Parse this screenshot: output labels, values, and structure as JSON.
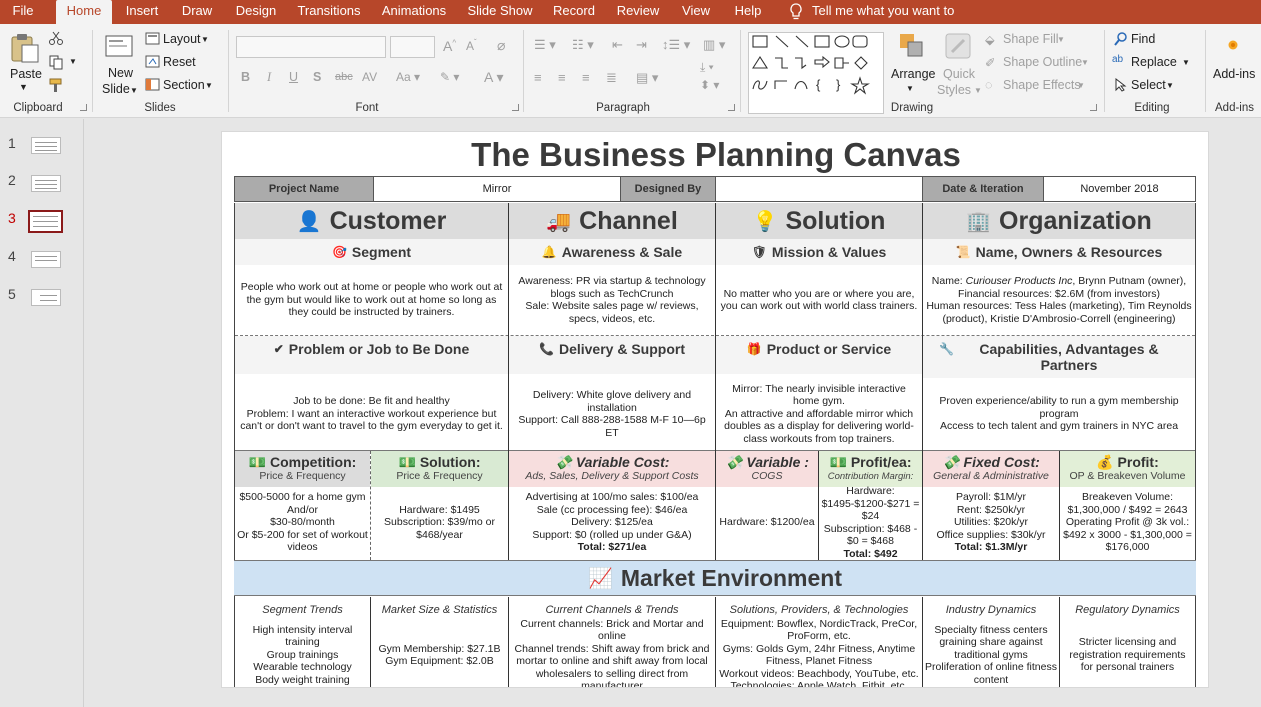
{
  "tabs": [
    "File",
    "Home",
    "Insert",
    "Draw",
    "Design",
    "Transitions",
    "Animations",
    "Slide Show",
    "Record",
    "Review",
    "View",
    "Help"
  ],
  "tell_me": "Tell me what you want to do",
  "ribbon": {
    "paste": "Paste",
    "clipboard": "Clipboard",
    "new_slide_1": "New",
    "new_slide_2": "Slide",
    "layout": "Layout",
    "reset": "Reset",
    "section": "Section",
    "slides": "Slides",
    "font": "Font",
    "paragraph": "Paragraph",
    "arrange": "Arrange",
    "quick_styles_1": "Quick",
    "quick_styles_2": "Styles",
    "shape_fill": "Shape Fill",
    "shape_outline": "Shape Outline",
    "shape_effects": "Shape Effects",
    "drawing": "Drawing",
    "find": "Find",
    "replace": "Replace",
    "select": "Select",
    "editing": "Editing",
    "addins": "Add-ins",
    "addins_group": "Add-ins"
  },
  "thumbnails": [
    "1",
    "2",
    "3",
    "4",
    "5"
  ],
  "selected_slide": 3,
  "slide": {
    "title": "The Business Planning Canvas",
    "info": {
      "project_name_label": "Project Name",
      "project_name": "Mirror",
      "designed_by_label": "Designed By",
      "designed_by": "",
      "date_label": "Date & Iteration",
      "date": "November 2018"
    },
    "columns": [
      {
        "icon": "👤",
        "title": "Customer"
      },
      {
        "icon": "🚚",
        "title": "Channel"
      },
      {
        "icon": "💡",
        "title": "Solution"
      },
      {
        "icon": "🏢",
        "title": "Organization"
      }
    ],
    "row1": [
      {
        "icon": "🎯",
        "heading": "Segment",
        "body": "People who work out at home or people who work out at the gym but would like to work out at home so long as they could be instructed by trainers."
      },
      {
        "icon": "🔔",
        "heading": "Awareness & Sale",
        "body": "Awareness: PR via startup & technology blogs such as TechCrunch\nSale: Website sales page w/ reviews, specs, videos, etc."
      },
      {
        "icon": "🛡",
        "heading": "Mission & Values",
        "body": "No matter who you are or where you are, you can work out with world class trainers."
      },
      {
        "icon": "📜",
        "heading": "Name, Owners & Resources",
        "body_prefix": "Name: ",
        "body_italic": "Curiouser Products Inc",
        "body": ", Brynn Putnam (owner), Financial resources: $2.6M (from investors)\nHuman resources: Tess Hales (marketing), Tim Reynolds (product), Kristie D'Ambrosio-Correll (engineering)"
      }
    ],
    "row2": [
      {
        "icon": "✔",
        "heading": "Problem or Job to Be Done",
        "body": "Job to be done: Be fit and healthy\nProblem: I want an interactive workout experience but can't or don't want to travel to the gym everyday to get it."
      },
      {
        "icon": "📞",
        "heading": "Delivery & Support",
        "body": "Delivery: White glove delivery and installation\nSupport: Call 888-288-1588 M-F 10—6p ET"
      },
      {
        "icon": "🎁",
        "heading": "Product or Service",
        "body": "Mirror: The nearly invisible interactive home gym.\nAn attractive and affordable mirror which doubles as a display for delivering world-class workouts from top trainers."
      },
      {
        "icon": "🔧",
        "heading": "Capabilities, Advantages & Partners",
        "body": "Proven experience/ability to run a gym membership program\nAccess to tech talent and gym trainers in NYC area"
      }
    ],
    "finance": [
      {
        "icon": "💵",
        "title": "Competition:",
        "sub": "Price & Frequency",
        "lines": [
          "$500-5000 for a home gym",
          "And/or",
          "$30-80/month",
          "Or $5-200 for set of workout videos"
        ]
      },
      {
        "icon": "💵",
        "title": "Solution:",
        "sub": "Price & Frequency",
        "lines": [
          "Hardware: $1495",
          "Subscription: $39/mo or $468/year"
        ]
      },
      {
        "icon": "💸",
        "title": "Variable Cost:",
        "sub": "Ads, Sales, Delivery & Support Costs",
        "lines": [
          "Advertising at 100/mo sales: $100/ea",
          "Sale (cc processing fee): $46/ea",
          "Delivery: $125/ea",
          "Support: $0 (rolled up under G&A)"
        ],
        "total": "Total: $271/ea"
      },
      {
        "icon": "💸",
        "title": "Variable :",
        "sub": "COGS",
        "lines": [
          "Hardware: $1200/ea"
        ]
      },
      {
        "icon": "💵",
        "title": "Profit/ea:",
        "sub": "Contribution Margin:",
        "lines": [
          "Hardware: $1495-$1200-$271 = $24",
          "Subscription: $468 - $0 = $468"
        ],
        "total": "Total: $492"
      },
      {
        "icon": "💸",
        "title": "Fixed Cost:",
        "sub": "General & Administrative",
        "lines": [
          "Payroll: $1M/yr",
          "Rent: $250k/yr",
          "Utilities: $20k/yr",
          "Office supplies: $30k/yr"
        ],
        "total": "Total: $1.3M/yr"
      },
      {
        "icon": "💰",
        "title": "Profit:",
        "sub": "OP & Breakeven Volume",
        "lines": [
          "Breakeven Volume:",
          "$1,300,000 / $492 = 2643",
          "Operating Profit @ 3k vol.:",
          "$492 x 3000 - $1,300,000 =",
          "$176,000"
        ]
      }
    ],
    "market": {
      "icon": "📈",
      "title": "Market Environment",
      "columns": [
        {
          "heading": "Segment Trends",
          "lines": [
            "High intensity interval training",
            "Group trainings",
            "Wearable technology",
            "Body weight training"
          ]
        },
        {
          "heading": "Market Size & Statistics",
          "lines": [
            "Gym Membership: $27.1B",
            "Gym Equipment: $2.0B"
          ]
        },
        {
          "heading": "Current Channels & Trends",
          "lines": [
            "Current channels: Brick and Mortar and online",
            "Channel trends: Shift away from brick and mortar to online and shift away from local wholesalers to selling direct from manufacturer"
          ]
        },
        {
          "heading": "Solutions, Providers, & Technologies",
          "lines": [
            "Equipment: Bowflex, NordicTrack, PreCor, ProForm, etc.",
            "Gyms: Golds Gym, 24hr Fitness, Anytime Fitness, Planet Fitness",
            "Workout videos: Beachbody, YouTube, etc.",
            "Technologies: Apple Watch, Fitbit, etc."
          ]
        },
        {
          "heading": "Industry Dynamics",
          "lines": [
            "Specialty fitness centers graining share against traditional gyms",
            "Proliferation of online fitness content"
          ]
        },
        {
          "heading": "Regulatory Dynamics",
          "lines": [
            "Stricter licensing and registration requirements for personal trainers"
          ]
        }
      ]
    }
  }
}
